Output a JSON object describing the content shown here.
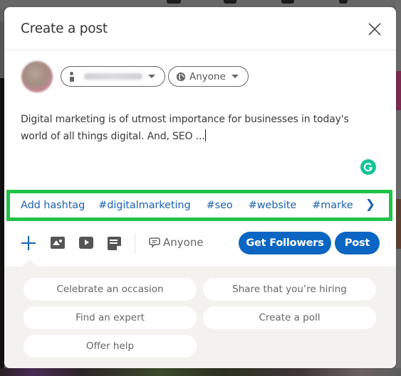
{
  "dialog": {
    "title": "Create a post",
    "close_label": "Close"
  },
  "identity": {
    "author_name": "[blurred name]",
    "visibility": "Anyone"
  },
  "composer": {
    "text_line1": "Digital marketing is of utmost importance for businesses in today's",
    "text_line2": "world of all things digital. And, SEO ..."
  },
  "hashtags": {
    "add_label": "Add hashtag",
    "items": [
      "#digitalmarketing",
      "#seo",
      "#website",
      "#marke"
    ],
    "highlight_color": "#22c24a"
  },
  "toolbar": {
    "comment_visibility": "Anyone",
    "get_followers_label": "Get Followers",
    "post_label": "Post",
    "primary_color": "#0a66c2"
  },
  "suggestions": {
    "items": [
      "Celebrate an occasion",
      "Share that you’re hiring",
      "Find an expert",
      "Create a poll",
      "Offer help"
    ]
  }
}
